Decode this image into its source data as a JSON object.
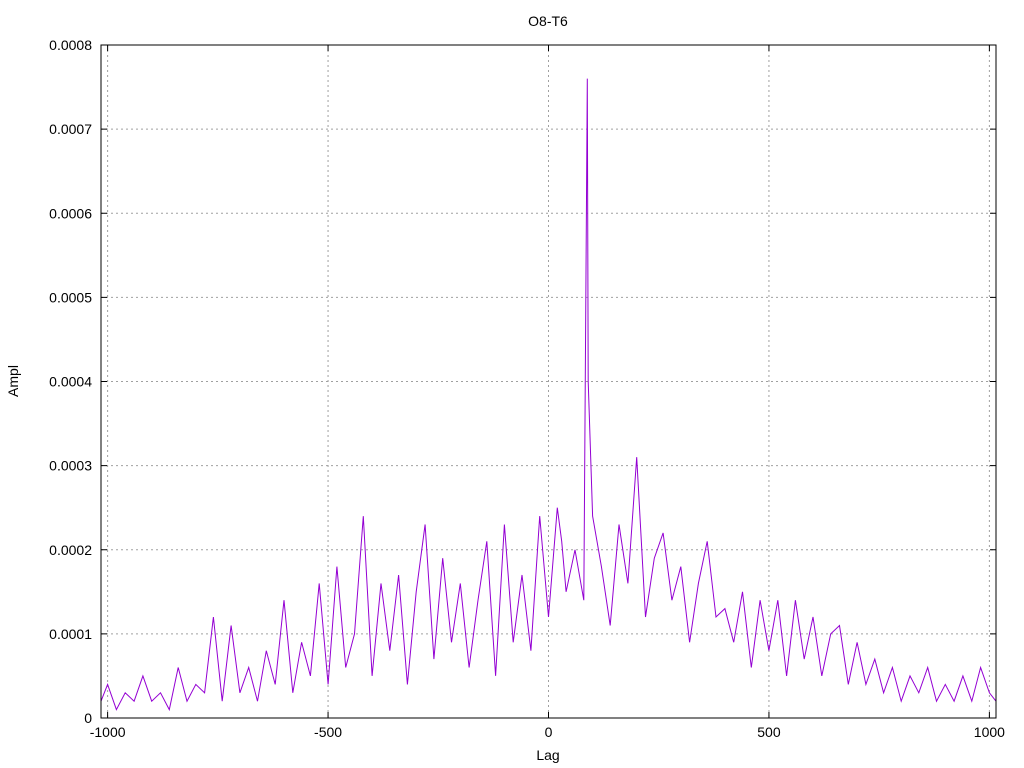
{
  "chart_data": {
    "type": "line",
    "title": "O8-T6",
    "xlabel": "Lag",
    "ylabel": "Ampl",
    "xlim": [
      -1015,
      1015
    ],
    "ylim": [
      0,
      0.0008
    ],
    "xticks": [
      -1000,
      -500,
      0,
      500,
      1000
    ],
    "xtick_labels": [
      "-1000",
      "-500",
      "0",
      "500",
      "1000"
    ],
    "yticks": [
      0,
      0.0001,
      0.0002,
      0.0003,
      0.0004,
      0.0005,
      0.0006,
      0.0007,
      0.0008
    ],
    "ytick_labels": [
      "0",
      "0.0001",
      "0.0002",
      "0.0003",
      "0.0004",
      "0.0005",
      "0.0006",
      "0.0007",
      "0.0008"
    ],
    "grid": true,
    "color": "#9400d3",
    "series": [
      {
        "x": [
          -1015,
          -1000,
          -980,
          -960,
          -940,
          -920,
          -900,
          -880,
          -860,
          -840,
          -820,
          -800,
          -780,
          -760,
          -740,
          -720,
          -700,
          -680,
          -660,
          -640,
          -620,
          -600,
          -580,
          -560,
          -540,
          -520,
          -500,
          -480,
          -460,
          -440,
          -420,
          -400,
          -380,
          -360,
          -340,
          -320,
          -300,
          -280,
          -260,
          -240,
          -220,
          -200,
          -180,
          -160,
          -140,
          -120,
          -100,
          -80,
          -60,
          -40,
          -20,
          0,
          20,
          30,
          40,
          60,
          80,
          88,
          90,
          100,
          120,
          140,
          160,
          180,
          200,
          220,
          240,
          260,
          280,
          300,
          320,
          340,
          360,
          380,
          400,
          420,
          440,
          460,
          480,
          500,
          520,
          540,
          560,
          580,
          600,
          620,
          640,
          660,
          680,
          700,
          720,
          740,
          760,
          780,
          800,
          820,
          840,
          860,
          880,
          900,
          920,
          940,
          960,
          980,
          1000,
          1015
        ],
        "y": [
          2e-05,
          4e-05,
          1e-05,
          3e-05,
          2e-05,
          5e-05,
          2e-05,
          3e-05,
          1e-05,
          6e-05,
          2e-05,
          4e-05,
          3e-05,
          0.00012,
          2e-05,
          0.00011,
          3e-05,
          6e-05,
          2e-05,
          8e-05,
          4e-05,
          0.00014,
          3e-05,
          9e-05,
          5e-05,
          0.00016,
          4e-05,
          0.00018,
          6e-05,
          0.0001,
          0.00024,
          5e-05,
          0.00016,
          8e-05,
          0.00017,
          4e-05,
          0.00015,
          0.00023,
          7e-05,
          0.00019,
          9e-05,
          0.00016,
          6e-05,
          0.00014,
          0.00021,
          5e-05,
          0.00023,
          9e-05,
          0.00017,
          8e-05,
          0.00024,
          0.00012,
          0.00025,
          0.00021,
          0.00015,
          0.0002,
          0.00014,
          0.00076,
          0.0004,
          0.00024,
          0.00018,
          0.00011,
          0.00023,
          0.00016,
          0.00031,
          0.00012,
          0.00019,
          0.00022,
          0.00014,
          0.00018,
          9e-05,
          0.00016,
          0.00021,
          0.00012,
          0.00013,
          9e-05,
          0.00015,
          6e-05,
          0.00014,
          8e-05,
          0.00014,
          5e-05,
          0.00014,
          7e-05,
          0.00012,
          5e-05,
          0.0001,
          0.00011,
          4e-05,
          9e-05,
          4e-05,
          7e-05,
          3e-05,
          6e-05,
          2e-05,
          5e-05,
          3e-05,
          6e-05,
          2e-05,
          4e-05,
          2e-05,
          5e-05,
          2e-05,
          6e-05,
          3e-05,
          2e-05
        ]
      }
    ]
  }
}
